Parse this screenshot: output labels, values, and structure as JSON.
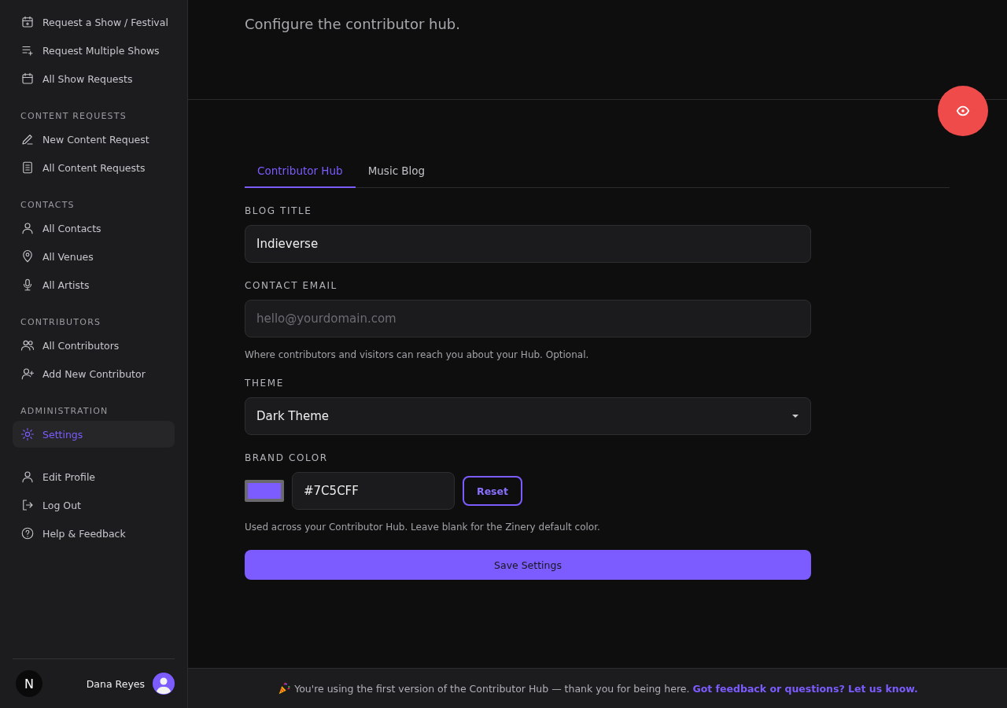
{
  "sidebar": {
    "sections": [
      {
        "items": [
          {
            "label": "Request a Show / Festival",
            "selected": false
          },
          {
            "label": "Request Multiple Shows",
            "selected": false
          },
          {
            "label": "All Show Requests",
            "selected": false
          }
        ]
      },
      {
        "heading": "CONTENT REQUESTS",
        "items": [
          {
            "label": "New Content Request",
            "selected": false
          },
          {
            "label": "All Content Requests",
            "selected": false
          }
        ]
      },
      {
        "heading": "CONTACTS",
        "items": [
          {
            "label": "All Contacts",
            "selected": false
          },
          {
            "label": "All Venues",
            "selected": false
          },
          {
            "label": "All Artists",
            "selected": false
          }
        ]
      },
      {
        "heading": "CONTRIBUTORS",
        "items": [
          {
            "label": "All Contributors",
            "selected": false
          },
          {
            "label": "Add New Contributor",
            "selected": false
          }
        ]
      },
      {
        "heading": "ADMINISTRATION",
        "items": [
          {
            "label": "Settings",
            "selected": true
          }
        ]
      }
    ],
    "account_items": [
      {
        "label": "Edit Profile"
      },
      {
        "label": "Log Out"
      },
      {
        "label": "Help & Feedback"
      }
    ],
    "logo": "N",
    "user": {
      "name": "Dana Reyes"
    }
  },
  "header": {
    "subtitle": "Configure the contributor hub."
  },
  "tabs": [
    {
      "label": "Contributor Hub",
      "selected": true
    },
    {
      "label": "Music Blog",
      "selected": false
    }
  ],
  "form": {
    "blog_title": {
      "label": "BLOG TITLE",
      "value": "Indieverse"
    },
    "contact_email": {
      "label": "CONTACT EMAIL",
      "placeholder": "hello@yourdomain.com",
      "help": "Where contributors and visitors can reach you about your Hub. Optional."
    },
    "theme": {
      "label": "THEME",
      "value": "Dark Theme"
    },
    "brand_color": {
      "label": "BRAND COLOR",
      "color": "#7c5cff",
      "value": "#7C5CFF",
      "reset": "Reset",
      "help": "Used across your Contributor Hub. Leave blank for the Zinery default color."
    },
    "save": "Save Settings"
  },
  "footer": {
    "text": "You're using the first version of the Contributor Hub — thank you for being here.",
    "link": "Got feedback or questions? Let us know."
  }
}
